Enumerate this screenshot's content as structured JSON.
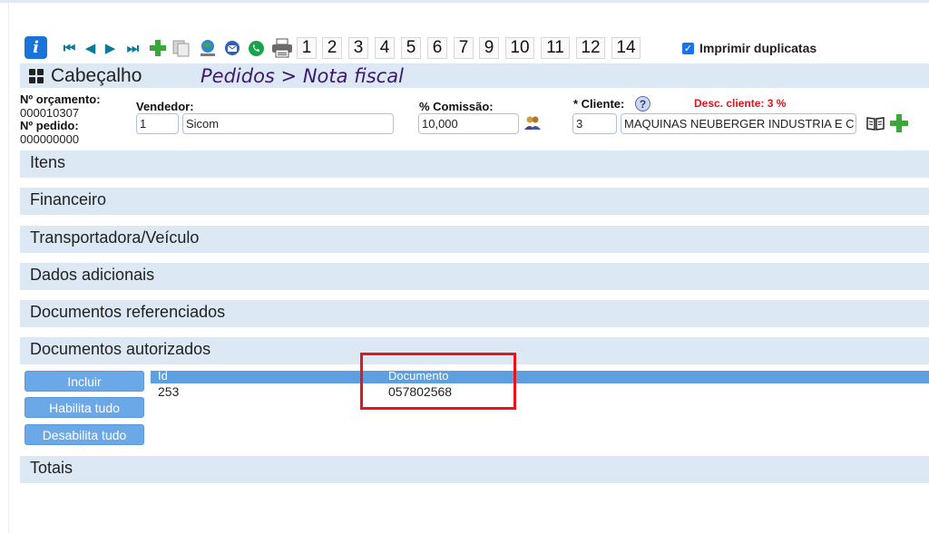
{
  "toolbar": {
    "icons": [
      "info-icon",
      "first-icon",
      "prev-icon",
      "next-icon",
      "last-icon",
      "add-icon",
      "copy-icon",
      "globe-icon",
      "email-icon",
      "whatsapp-icon",
      "print-icon"
    ],
    "nav_first": "⏮",
    "nav_prev": "◀",
    "nav_next": "▶",
    "nav_last": "⏭",
    "info_label": "i",
    "pages": [
      "1",
      "2",
      "3",
      "4",
      "5",
      "6",
      "7",
      "9",
      "10",
      "11",
      "12",
      "14"
    ],
    "print_duplicates_label": "Imprimir duplicatas",
    "print_duplicates_checked": true
  },
  "header": {
    "title": "Cabeçalho",
    "breadcrumb": "Pedidos > Nota fiscal"
  },
  "form": {
    "budget_label": "Nº orçamento:",
    "budget_value": "000010307",
    "order_label": "Nº pedido:",
    "order_value": "000000000",
    "seller_label": "Vendedor:",
    "seller_id": "1",
    "seller_name": "Sicom",
    "commission_label": "% Comissão:",
    "commission_value": "10,000",
    "client_label": "* Cliente:",
    "help_label": "?",
    "client_discount": "Desc. cliente: 3 %",
    "client_id": "3",
    "client_name": "MAQUINAS NEUBERGER INDUSTRIA E C"
  },
  "sections": {
    "itens": "Itens",
    "financeiro": "Financeiro",
    "transportadora": "Transportadora/Veículo",
    "dados": "Dados adicionais",
    "referenciados": "Documentos referenciados",
    "autorizados": "Documentos autorizados",
    "totais": "Totais"
  },
  "authorized_docs": {
    "buttons": {
      "include": "Incluir",
      "enable_all": "Habilita tudo",
      "disable_all": "Desabilita tudo"
    },
    "columns": [
      "Id",
      "Documento"
    ],
    "rows": [
      [
        "253",
        "057802568"
      ]
    ]
  },
  "colors": {
    "accent": "#5d9fe0",
    "section_bg": "#dce8f4",
    "breadcrumb": "#3d1a6e",
    "discount": "#e0141e",
    "highlight": "#e8141a"
  }
}
